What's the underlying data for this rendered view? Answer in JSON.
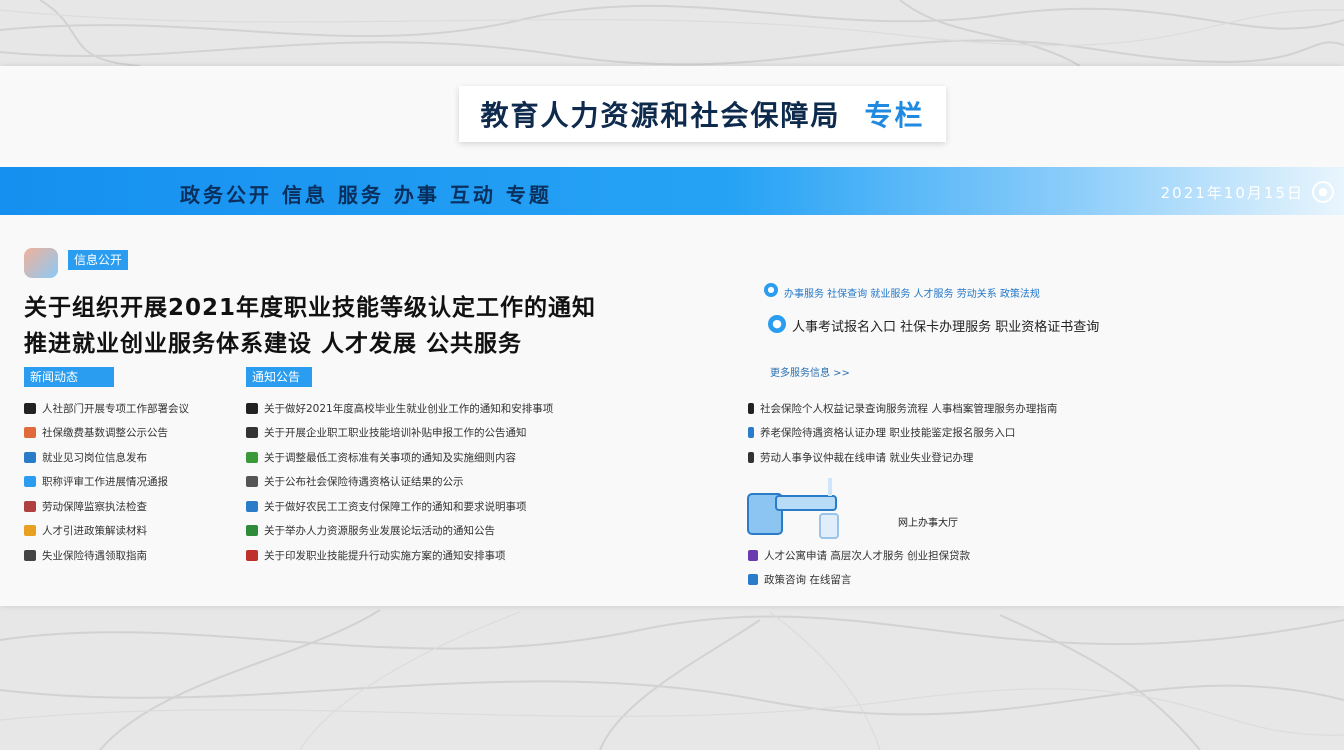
{
  "header": {
    "title": "教育人力资源和社会保障局",
    "title_accent": "专栏"
  },
  "navbar": {
    "label": "政务公开 信息 服务 办事 互动 专题",
    "right_text": "2021年10月15日",
    "right_icon": "search-icon"
  },
  "left": {
    "tag1": "信息公开",
    "headline1": "关于组织开展2021年度职业技能等级认定工作的通知",
    "headline2": "推进就业创业服务体系建设 人才发展 公共服务",
    "tag2": "新闻动态",
    "tag3": "通知公告",
    "col1": [
      "人社部门开展专项工作部署会议",
      "社保缴费基数调整公示公告",
      "就业见习岗位信息发布",
      "职称评审工作进展情况通报",
      "劳动保障监察执法检查",
      "人才引进政策解读材料",
      "失业保险待遇领取指南"
    ],
    "col2": [
      "关于做好2021年度高校毕业生就业创业工作的通知和安排事项",
      "关于开展企业职工职业技能培训补贴申报工作的公告通知",
      "关于调整最低工资标准有关事项的通知及实施细则内容",
      "关于公布社会保险待遇资格认证结果的公示",
      "关于做好农民工工资支付保障工作的通知和要求说明事项",
      "关于举办人力资源服务业发展论坛活动的通知公告",
      "关于印发职业技能提升行动实施方案的通知安排事项"
    ]
  },
  "right": {
    "top_link": "办事服务 社保查询 就业服务 人才服务 劳动关系 政策法规",
    "top_text": "人事考试报名入口 社保卡办理服务 职业资格证书查询",
    "small_link": "更多服务信息 >>",
    "col3": [
      "社会保险个人权益记录查询服务流程 人事档案管理服务办理指南",
      "养老保险待遇资格认证办理 职业技能鉴定报名服务入口",
      "劳动人事争议仲裁在线申请 就业失业登记办理"
    ],
    "illus_caption": "网上办事大厅",
    "col4": [
      "人才公寓申请 高层次人才服务 创业担保贷款",
      "政策咨询 在线留言"
    ]
  },
  "colors": {
    "accent": "#2a9df0",
    "bar_start": "#1590f0",
    "headline": "#111111"
  }
}
